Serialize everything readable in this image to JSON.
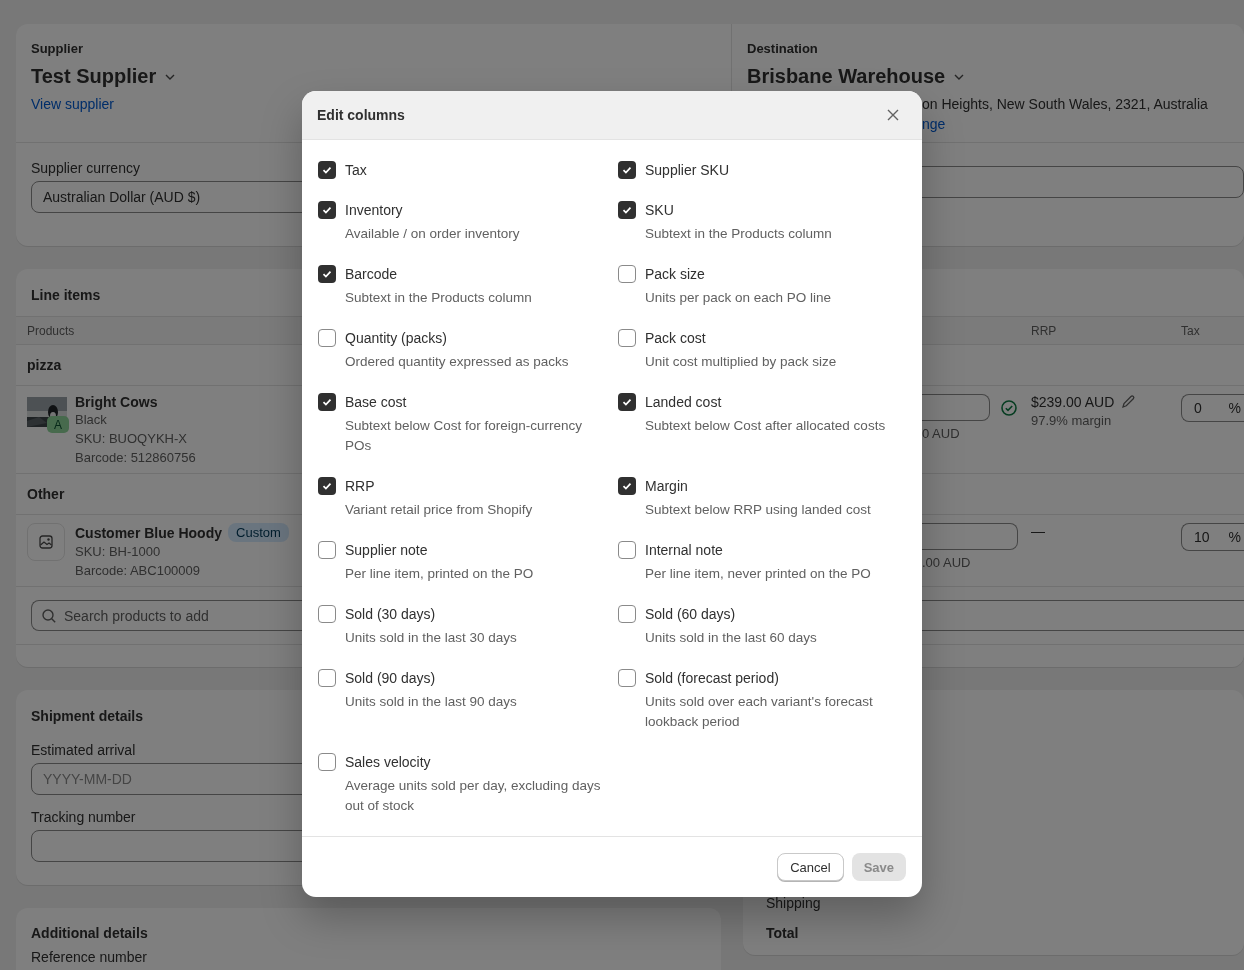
{
  "supplier": {
    "label": "Supplier",
    "name": "Test Supplier",
    "link": "View supplier",
    "currency_label": "Supplier currency",
    "currency": "Australian Dollar (AUD $)"
  },
  "destination": {
    "label": "Destination",
    "name": "Brisbane Warehouse",
    "address": "on Heights, New South Wales, 2321, Australia",
    "link": "nge"
  },
  "line_items": {
    "title": "Line items",
    "columns": [
      "Products",
      "RRP",
      "Tax"
    ],
    "groups": [
      {
        "name": "pizza",
        "items": [
          {
            "name": "Bright Cows",
            "variant": "Black",
            "sku": "SKU: BUOQYKH-X",
            "barcode": "Barcode: 512860756",
            "badge": "A",
            "cost_note": "0 AUD",
            "cost_ok": true,
            "rrp": "$239.00 AUD",
            "margin": "97.9% margin",
            "tax": "0",
            "tax_unit": "%"
          }
        ]
      },
      {
        "name": "Other",
        "items": [
          {
            "name": "Customer Blue Hoody",
            "tag": "Custom",
            "sku": "SKU: BH-1000",
            "barcode": "Barcode: ABC100009",
            "kind": "placeholder",
            "cost_note": ".00 AUD",
            "cost_ok": false,
            "rrp": "—",
            "tax": "10",
            "tax_unit": "%"
          }
        ]
      }
    ],
    "search_placeholder": "Search products to add"
  },
  "shipment": {
    "title": "Shipment details",
    "fields": [
      {
        "label": "Estimated arrival",
        "placeholder": "YYYY-MM-DD"
      },
      {
        "label": "Tracking number"
      }
    ]
  },
  "summary": {
    "rows": [
      {
        "label": "Shipping",
        "kind": "line"
      },
      {
        "label": "Total",
        "kind": "total"
      }
    ]
  },
  "additional": {
    "title": "Additional details",
    "fields": [
      {
        "label": "Reference number"
      }
    ]
  },
  "modal": {
    "title": "Edit columns",
    "columns": [
      {
        "label": "Tax",
        "checked": true
      },
      {
        "label": "Supplier SKU",
        "checked": true
      },
      {
        "label": "Inventory",
        "description": "Available / on order inventory",
        "checked": true
      },
      {
        "label": "SKU",
        "description": "Subtext in the Products column",
        "checked": true
      },
      {
        "label": "Barcode",
        "description": "Subtext in the Products column",
        "checked": true
      },
      {
        "label": "Pack size",
        "description": "Units per pack on each PO line",
        "checked": false
      },
      {
        "label": "Quantity (packs)",
        "description": "Ordered quantity expressed as packs",
        "checked": false
      },
      {
        "label": "Pack cost",
        "description": "Unit cost multiplied by pack size",
        "checked": false
      },
      {
        "label": "Base cost",
        "description": "Subtext below Cost for foreign-currency POs",
        "checked": true
      },
      {
        "label": "Landed cost",
        "description": "Subtext below Cost after allocated costs",
        "checked": true
      },
      {
        "label": "RRP",
        "description": "Variant retail price from Shopify",
        "checked": true
      },
      {
        "label": "Margin",
        "description": "Subtext below RRP using landed cost",
        "checked": true
      },
      {
        "label": "Supplier note",
        "description": "Per line item, printed on the PO",
        "checked": false
      },
      {
        "label": "Internal note",
        "description": "Per line item, never printed on the PO",
        "checked": false
      },
      {
        "label": "Sold (30 days)",
        "description": "Units sold in the last 30 days",
        "checked": false
      },
      {
        "label": "Sold (60 days)",
        "description": "Units sold in the last 60 days",
        "checked": false
      },
      {
        "label": "Sold (90 days)",
        "description": "Units sold in the last 90 days",
        "checked": false
      },
      {
        "label": "Sold (forecast period)",
        "description": "Units sold over each variant's forecast lookback period",
        "checked": false
      },
      {
        "label": "Sales velocity",
        "description": "Average units sold per day, excluding days out of stock",
        "checked": false
      }
    ],
    "buttons": [
      {
        "label": "Cancel",
        "kind": "secondary",
        "disabled": false
      },
      {
        "label": "Save",
        "kind": "primary",
        "disabled": true
      }
    ]
  }
}
